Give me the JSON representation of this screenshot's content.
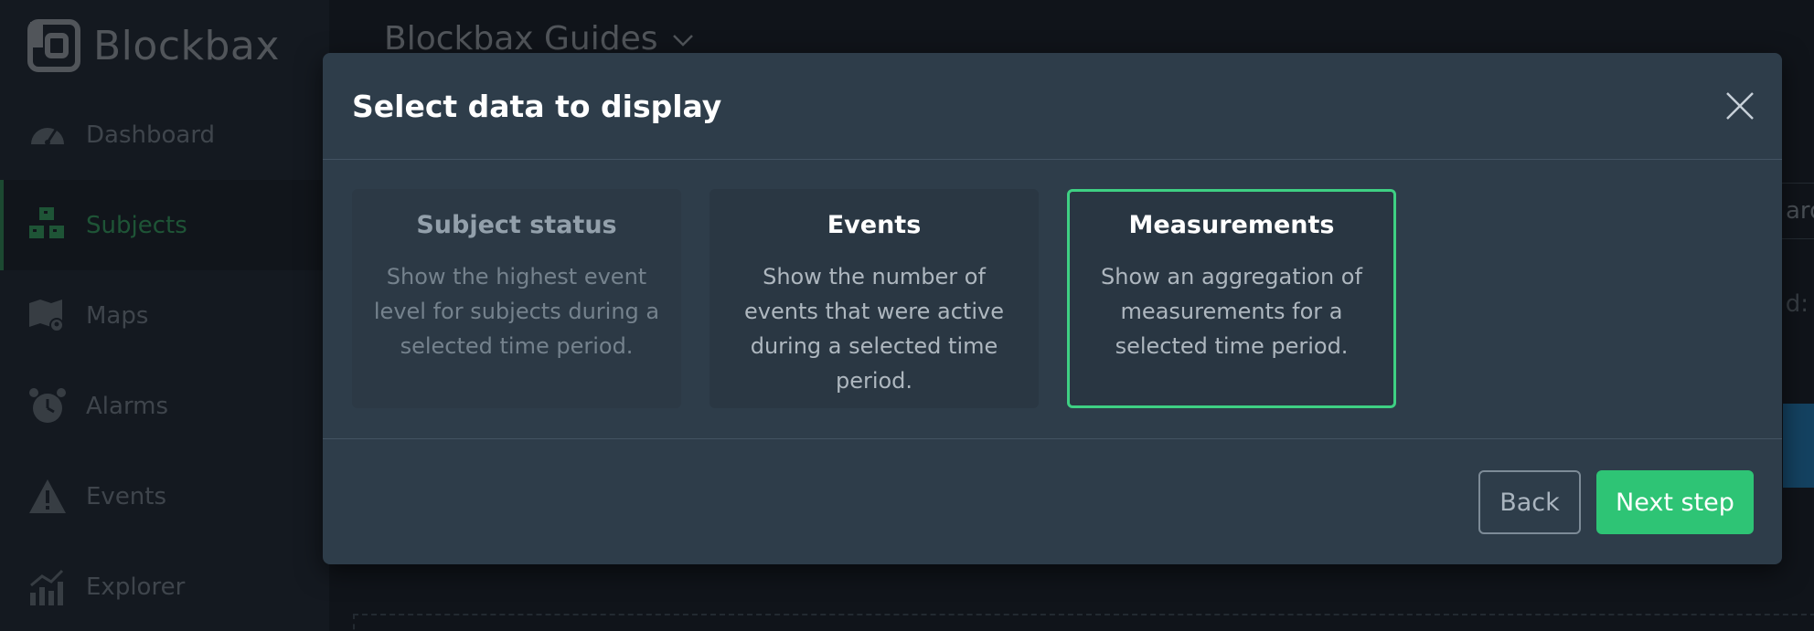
{
  "app": {
    "brand": "Blockbax"
  },
  "sidebar": {
    "items": [
      {
        "label": "Dashboard",
        "icon": "gauge-icon"
      },
      {
        "label": "Subjects",
        "icon": "cubes-icon"
      },
      {
        "label": "Maps",
        "icon": "map-pin-icon"
      },
      {
        "label": "Alarms",
        "icon": "alarm-clock-icon"
      },
      {
        "label": "Events",
        "icon": "warning-icon"
      },
      {
        "label": "Explorer",
        "icon": "chart-icon"
      }
    ]
  },
  "main": {
    "title": "Blockbax Guides",
    "right_box_text": "ard",
    "right_label": "d:"
  },
  "modal": {
    "title": "Select data to display",
    "cards": [
      {
        "title": "Subject status",
        "desc": "Show the highest event level for subjects during a selected time period."
      },
      {
        "title": "Events",
        "desc": "Show the number of events that were active during a selected time period."
      },
      {
        "title": "Measurements",
        "desc": "Show an aggregation of measurements for a selected time period."
      }
    ],
    "back_label": "Back",
    "next_label": "Next step"
  },
  "colors": {
    "accent_green": "#2ec475",
    "selected_border": "#3ed083",
    "modal_bg": "#2e3d4a",
    "sidebar_active": "#2f8f55"
  }
}
